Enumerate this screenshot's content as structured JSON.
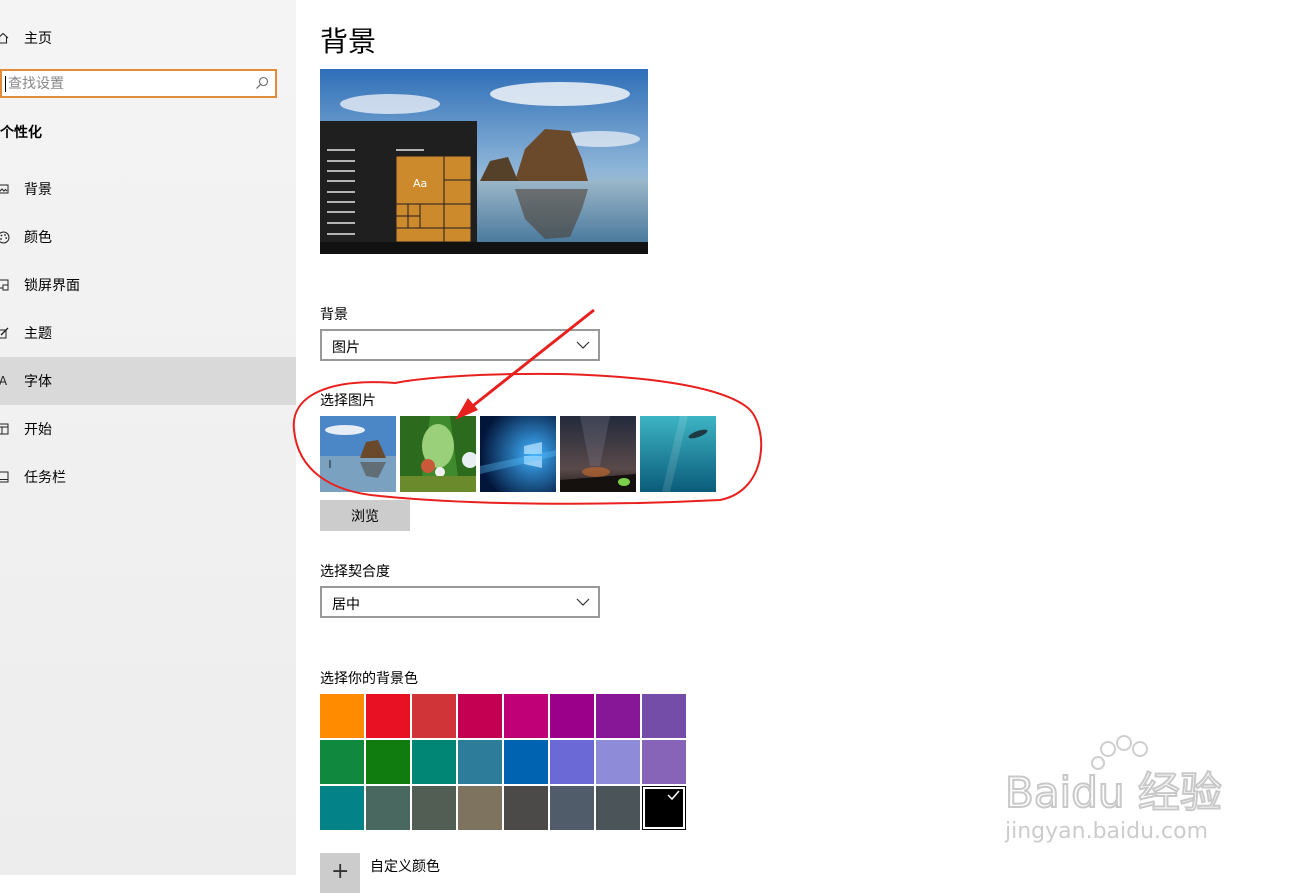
{
  "sidebar": {
    "home_label": "主页",
    "search_placeholder": "查找设置",
    "section_title": "个性化",
    "items": [
      {
        "label": "背景",
        "icon": "image-icon"
      },
      {
        "label": "颜色",
        "icon": "palette-icon"
      },
      {
        "label": "锁屏界面",
        "icon": "lock-screen-icon"
      },
      {
        "label": "主题",
        "icon": "brush-icon"
      },
      {
        "label": "字体",
        "icon": "font-icon"
      },
      {
        "label": "开始",
        "icon": "start-icon"
      },
      {
        "label": "任务栏",
        "icon": "taskbar-icon"
      }
    ],
    "selected_item": "字体"
  },
  "main": {
    "title": "背景",
    "preview": {
      "tile_text": "Aa"
    },
    "background_label": "背景",
    "background_value": "图片",
    "choose_picture_label": "选择图片",
    "pictures": [
      "beach-rock-icon",
      "forest-anime-icon",
      "windows-blue-icon",
      "night-sky-icon",
      "underwater-icon"
    ],
    "browse_label": "浏览",
    "fit_label": "选择契合度",
    "fit_value": "居中",
    "color_label": "选择你的背景色",
    "colors": [
      [
        "#ff8c00",
        "#e81123",
        "#d13438",
        "#c30052",
        "#bf0077",
        "#9a0089",
        "#881798",
        "#744da9"
      ],
      [
        "#10893e",
        "#107c10",
        "#018574",
        "#2d7d9a",
        "#0063b1",
        "#6b69d6",
        "#8e8cd8",
        "#8764b8"
      ],
      [
        "#038387",
        "#486860",
        "#525e54",
        "#7e735f",
        "#4c4a48",
        "#515c6b",
        "#4a5459",
        "#000000"
      ]
    ],
    "selected_color": "#000000",
    "custom_color_label": "自定义颜色"
  },
  "watermark": {
    "brand": "Baidu 经验",
    "url": "jingyan.baidu.com"
  }
}
